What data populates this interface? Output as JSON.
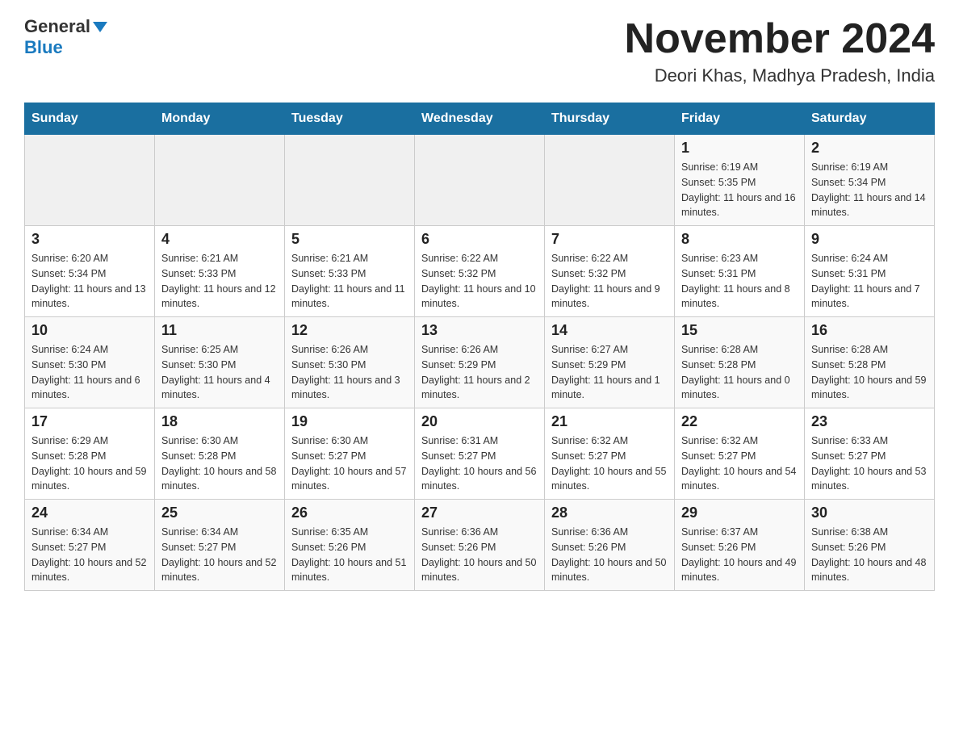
{
  "header": {
    "logo_text_general": "General",
    "logo_text_blue": "Blue",
    "month_title": "November 2024",
    "location": "Deori Khas, Madhya Pradesh, India"
  },
  "days_of_week": [
    "Sunday",
    "Monday",
    "Tuesday",
    "Wednesday",
    "Thursday",
    "Friday",
    "Saturday"
  ],
  "weeks": [
    [
      {
        "day": "",
        "info": ""
      },
      {
        "day": "",
        "info": ""
      },
      {
        "day": "",
        "info": ""
      },
      {
        "day": "",
        "info": ""
      },
      {
        "day": "",
        "info": ""
      },
      {
        "day": "1",
        "info": "Sunrise: 6:19 AM\nSunset: 5:35 PM\nDaylight: 11 hours and 16 minutes."
      },
      {
        "day": "2",
        "info": "Sunrise: 6:19 AM\nSunset: 5:34 PM\nDaylight: 11 hours and 14 minutes."
      }
    ],
    [
      {
        "day": "3",
        "info": "Sunrise: 6:20 AM\nSunset: 5:34 PM\nDaylight: 11 hours and 13 minutes."
      },
      {
        "day": "4",
        "info": "Sunrise: 6:21 AM\nSunset: 5:33 PM\nDaylight: 11 hours and 12 minutes."
      },
      {
        "day": "5",
        "info": "Sunrise: 6:21 AM\nSunset: 5:33 PM\nDaylight: 11 hours and 11 minutes."
      },
      {
        "day": "6",
        "info": "Sunrise: 6:22 AM\nSunset: 5:32 PM\nDaylight: 11 hours and 10 minutes."
      },
      {
        "day": "7",
        "info": "Sunrise: 6:22 AM\nSunset: 5:32 PM\nDaylight: 11 hours and 9 minutes."
      },
      {
        "day": "8",
        "info": "Sunrise: 6:23 AM\nSunset: 5:31 PM\nDaylight: 11 hours and 8 minutes."
      },
      {
        "day": "9",
        "info": "Sunrise: 6:24 AM\nSunset: 5:31 PM\nDaylight: 11 hours and 7 minutes."
      }
    ],
    [
      {
        "day": "10",
        "info": "Sunrise: 6:24 AM\nSunset: 5:30 PM\nDaylight: 11 hours and 6 minutes."
      },
      {
        "day": "11",
        "info": "Sunrise: 6:25 AM\nSunset: 5:30 PM\nDaylight: 11 hours and 4 minutes."
      },
      {
        "day": "12",
        "info": "Sunrise: 6:26 AM\nSunset: 5:30 PM\nDaylight: 11 hours and 3 minutes."
      },
      {
        "day": "13",
        "info": "Sunrise: 6:26 AM\nSunset: 5:29 PM\nDaylight: 11 hours and 2 minutes."
      },
      {
        "day": "14",
        "info": "Sunrise: 6:27 AM\nSunset: 5:29 PM\nDaylight: 11 hours and 1 minute."
      },
      {
        "day": "15",
        "info": "Sunrise: 6:28 AM\nSunset: 5:28 PM\nDaylight: 11 hours and 0 minutes."
      },
      {
        "day": "16",
        "info": "Sunrise: 6:28 AM\nSunset: 5:28 PM\nDaylight: 10 hours and 59 minutes."
      }
    ],
    [
      {
        "day": "17",
        "info": "Sunrise: 6:29 AM\nSunset: 5:28 PM\nDaylight: 10 hours and 59 minutes."
      },
      {
        "day": "18",
        "info": "Sunrise: 6:30 AM\nSunset: 5:28 PM\nDaylight: 10 hours and 58 minutes."
      },
      {
        "day": "19",
        "info": "Sunrise: 6:30 AM\nSunset: 5:27 PM\nDaylight: 10 hours and 57 minutes."
      },
      {
        "day": "20",
        "info": "Sunrise: 6:31 AM\nSunset: 5:27 PM\nDaylight: 10 hours and 56 minutes."
      },
      {
        "day": "21",
        "info": "Sunrise: 6:32 AM\nSunset: 5:27 PM\nDaylight: 10 hours and 55 minutes."
      },
      {
        "day": "22",
        "info": "Sunrise: 6:32 AM\nSunset: 5:27 PM\nDaylight: 10 hours and 54 minutes."
      },
      {
        "day": "23",
        "info": "Sunrise: 6:33 AM\nSunset: 5:27 PM\nDaylight: 10 hours and 53 minutes."
      }
    ],
    [
      {
        "day": "24",
        "info": "Sunrise: 6:34 AM\nSunset: 5:27 PM\nDaylight: 10 hours and 52 minutes."
      },
      {
        "day": "25",
        "info": "Sunrise: 6:34 AM\nSunset: 5:27 PM\nDaylight: 10 hours and 52 minutes."
      },
      {
        "day": "26",
        "info": "Sunrise: 6:35 AM\nSunset: 5:26 PM\nDaylight: 10 hours and 51 minutes."
      },
      {
        "day": "27",
        "info": "Sunrise: 6:36 AM\nSunset: 5:26 PM\nDaylight: 10 hours and 50 minutes."
      },
      {
        "day": "28",
        "info": "Sunrise: 6:36 AM\nSunset: 5:26 PM\nDaylight: 10 hours and 50 minutes."
      },
      {
        "day": "29",
        "info": "Sunrise: 6:37 AM\nSunset: 5:26 PM\nDaylight: 10 hours and 49 minutes."
      },
      {
        "day": "30",
        "info": "Sunrise: 6:38 AM\nSunset: 5:26 PM\nDaylight: 10 hours and 48 minutes."
      }
    ]
  ]
}
